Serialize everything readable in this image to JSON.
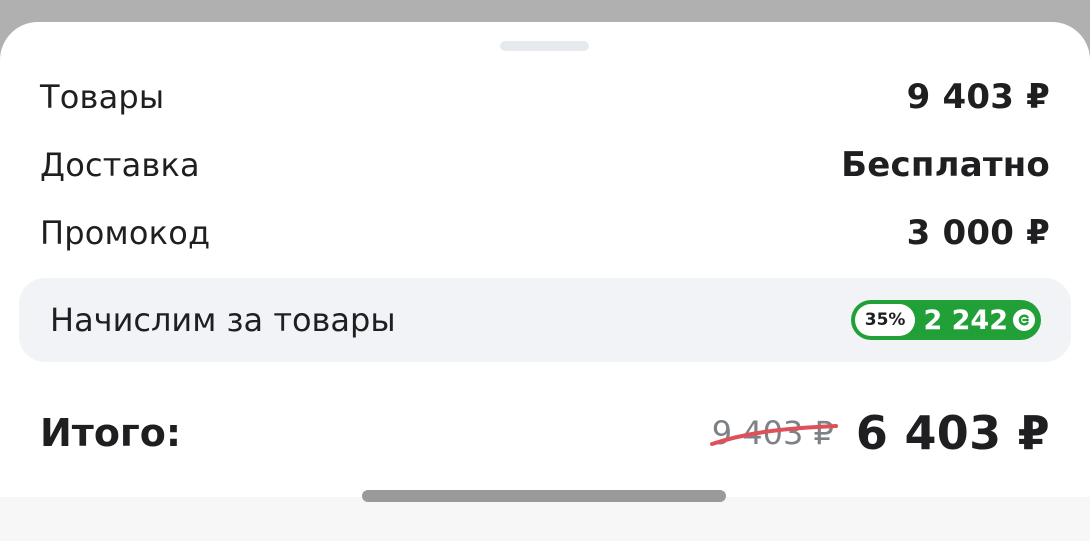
{
  "summary": {
    "goods": {
      "label": "Товары",
      "value": "9 403 ₽"
    },
    "delivery": {
      "label": "Доставка",
      "value": "Бесплатно"
    },
    "promo": {
      "label": "Промокод",
      "value": "3 000 ₽"
    }
  },
  "bonus": {
    "label": "Начислим за товары",
    "percent": "35%",
    "amount": "2 242",
    "coin_icon": "bonus-coin-icon",
    "badge_color": "#21a038"
  },
  "total": {
    "label": "Итого:",
    "old_price": "9 403 ₽",
    "new_price": "6 403 ₽",
    "strike_color": "#e0505a"
  }
}
